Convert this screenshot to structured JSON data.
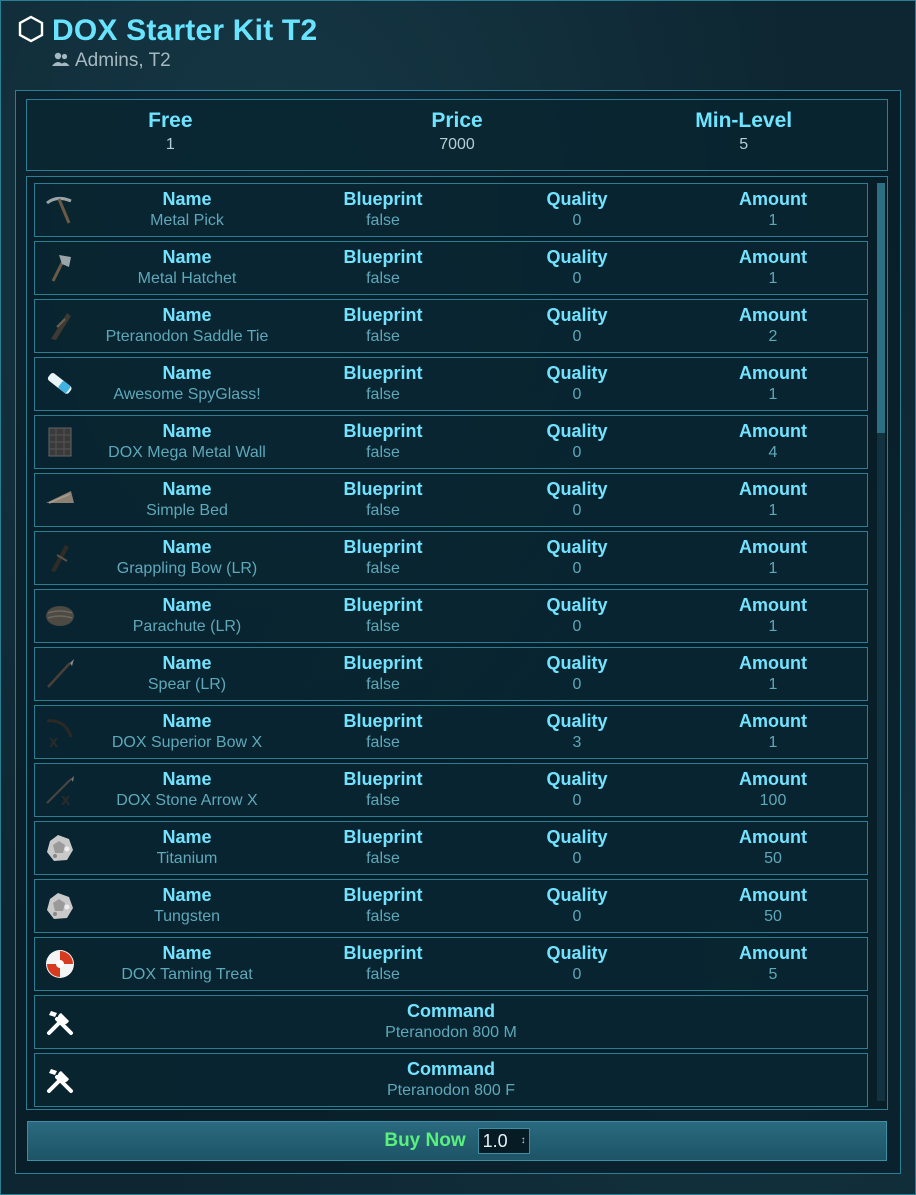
{
  "header": {
    "title": "DOX Starter Kit T2",
    "subtitle": "Admins, T2",
    "title_icon": "hexagon-icon",
    "subtitle_icon": "users-icon"
  },
  "stats": [
    {
      "label": "Free",
      "value": "1"
    },
    {
      "label": "Price",
      "value": "7000"
    },
    {
      "label": "Min-Level",
      "value": "5"
    }
  ],
  "columns": {
    "name": "Name",
    "blueprint": "Blueprint",
    "quality": "Quality",
    "amount": "Amount",
    "command": "Command"
  },
  "items": [
    {
      "icon": "pickaxe-icon",
      "name": "Metal Pick",
      "blueprint": "false",
      "quality": "0",
      "amount": "1"
    },
    {
      "icon": "hatchet-icon",
      "name": "Metal Hatchet",
      "blueprint": "false",
      "quality": "0",
      "amount": "1"
    },
    {
      "icon": "saddle-icon",
      "name": "Pteranodon Saddle Tie",
      "blueprint": "false",
      "quality": "0",
      "amount": "2"
    },
    {
      "icon": "spyglass-icon",
      "name": "Awesome SpyGlass!",
      "blueprint": "false",
      "quality": "0",
      "amount": "1"
    },
    {
      "icon": "wall-icon",
      "name": "DOX Mega Metal Wall",
      "blueprint": "false",
      "quality": "0",
      "amount": "4"
    },
    {
      "icon": "bed-icon",
      "name": "Simple Bed",
      "blueprint": "false",
      "quality": "0",
      "amount": "1"
    },
    {
      "icon": "bow-icon",
      "name": "Grappling Bow (LR)",
      "blueprint": "false",
      "quality": "0",
      "amount": "1"
    },
    {
      "icon": "parachute-icon",
      "name": "Parachute (LR)",
      "blueprint": "false",
      "quality": "0",
      "amount": "1"
    },
    {
      "icon": "spear-icon",
      "name": "Spear (LR)",
      "blueprint": "false",
      "quality": "0",
      "amount": "1"
    },
    {
      "icon": "superior-bow-icon",
      "name": "DOX Superior Bow X",
      "blueprint": "false",
      "quality": "3",
      "amount": "1"
    },
    {
      "icon": "arrow-icon",
      "name": "DOX Stone Arrow X",
      "blueprint": "false",
      "quality": "0",
      "amount": "100"
    },
    {
      "icon": "ore-icon",
      "name": "Titanium",
      "blueprint": "false",
      "quality": "0",
      "amount": "50"
    },
    {
      "icon": "ore-icon",
      "name": "Tungsten",
      "blueprint": "false",
      "quality": "0",
      "amount": "50"
    },
    {
      "icon": "taming-treat-icon",
      "name": "DOX Taming Treat",
      "blueprint": "false",
      "quality": "0",
      "amount": "5"
    }
  ],
  "commands": [
    {
      "icon": "tools-icon",
      "value": "Pteranodon 800 M"
    },
    {
      "icon": "tools-icon",
      "value": "Pteranodon 800 F"
    }
  ],
  "buy": {
    "label": "Buy Now",
    "quantity": "1.0"
  },
  "colors": {
    "accent": "#69e4ff",
    "buy_label": "#59f07c",
    "border": "#2a7f95"
  }
}
